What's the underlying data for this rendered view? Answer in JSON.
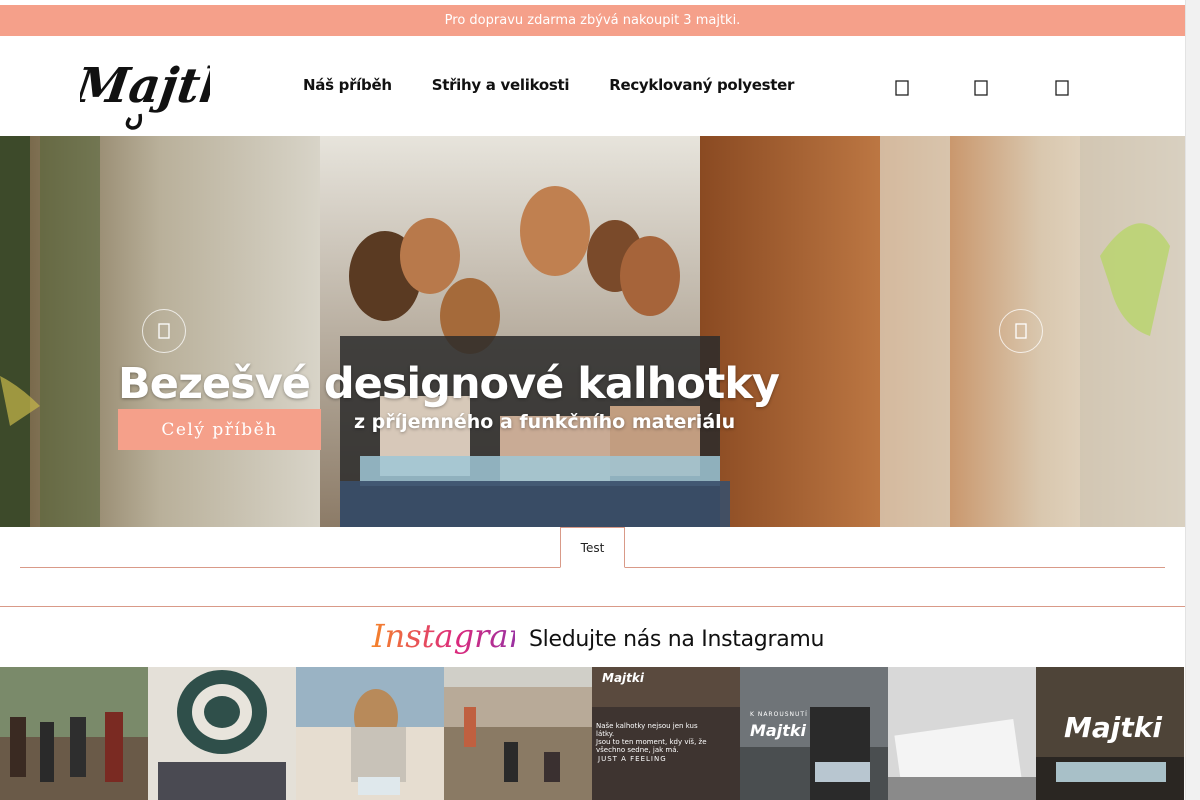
{
  "promo": {
    "text": "Pro dopravu zdarma zbývá nakoupit 3 majtki."
  },
  "header": {
    "logo_text": "Majtki",
    "nav": [
      {
        "label": "Náš příběh"
      },
      {
        "label": "Střihy a velikosti"
      },
      {
        "label": "Recyklovaný polyester"
      }
    ],
    "icons": [
      "search-icon",
      "user-icon",
      "cart-icon"
    ]
  },
  "hero": {
    "headline": "Bezešvé designové kalhotky",
    "subline": "z příjemného a funkčního materiálu",
    "cta_label": "Celý příběh",
    "prev_icon": "chevron-left-icon",
    "next_icon": "chevron-right-icon"
  },
  "tabs": {
    "items": [
      {
        "label": "Test"
      }
    ]
  },
  "instagram": {
    "logo_text": "Instagram",
    "title": "Sledujte nás na Instagramu",
    "tiles": [
      {
        "caption": ""
      },
      {
        "caption": ""
      },
      {
        "caption": ""
      },
      {
        "caption": ""
      },
      {
        "caption": "Majtki"
      },
      {
        "caption": "Majtki"
      },
      {
        "caption": ""
      },
      {
        "caption": "Majtki"
      }
    ],
    "tile_texts": {
      "t5_line1": "Naše kalhotky nejsou jen kus látky.",
      "t5_line2": "Jsou to ten moment, kdy víš, že",
      "t5_line3": "všechno sedne, jak má.",
      "t5_footer": "JUST A FEELING",
      "t6_top": "K NAROUSNUTÍ"
    }
  },
  "colors": {
    "accent": "#f5a08a",
    "divider": "#d99a88"
  }
}
